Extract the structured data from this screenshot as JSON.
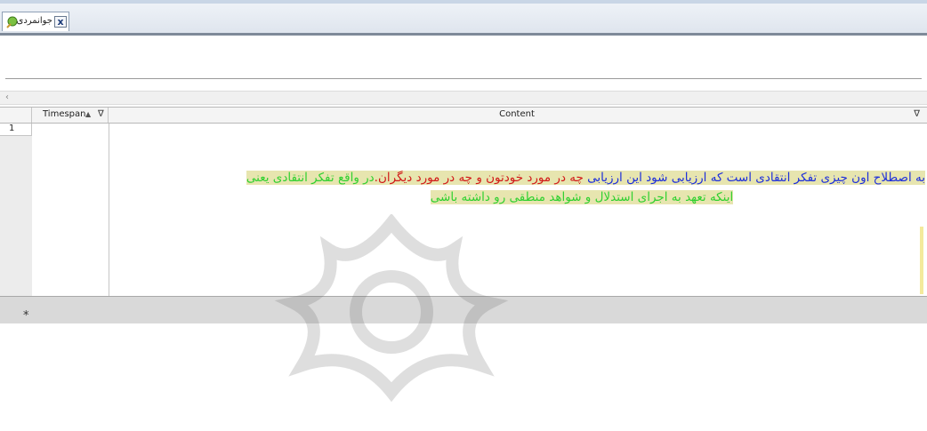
{
  "tab": {
    "label": "جوانمردی",
    "icon": "tag-icon",
    "close_symbol": "x"
  },
  "scroll": {
    "left_arrow": "‹"
  },
  "grid": {
    "columns": {
      "timespan": "Timespan",
      "timespan_sort": "▲",
      "content": "Content",
      "filter_symbol": "∇"
    },
    "rows": [
      {
        "number": "1",
        "timespan": ""
      }
    ],
    "new_row_symbol": "*"
  },
  "caption": {
    "line1_blue": "به اصطلاح اون چیزی  تفکر انتقادی است که ارزیابی شود این ارزیابی",
    "line1_red": " چه در مورد خودتون و چه در مورد دیگران.",
    "line1_green": "در واقع تفکر انتقادی یعنی",
    "line2_green": "اینکه تعهد به اجرای استدلال و شواهد منطقی رو داشته باشی"
  },
  "colors": {
    "caption_blue": "#1c2edc",
    "caption_red": "#d11818",
    "caption_green": "#2fd02f",
    "highlight": "#d4cf6e"
  }
}
